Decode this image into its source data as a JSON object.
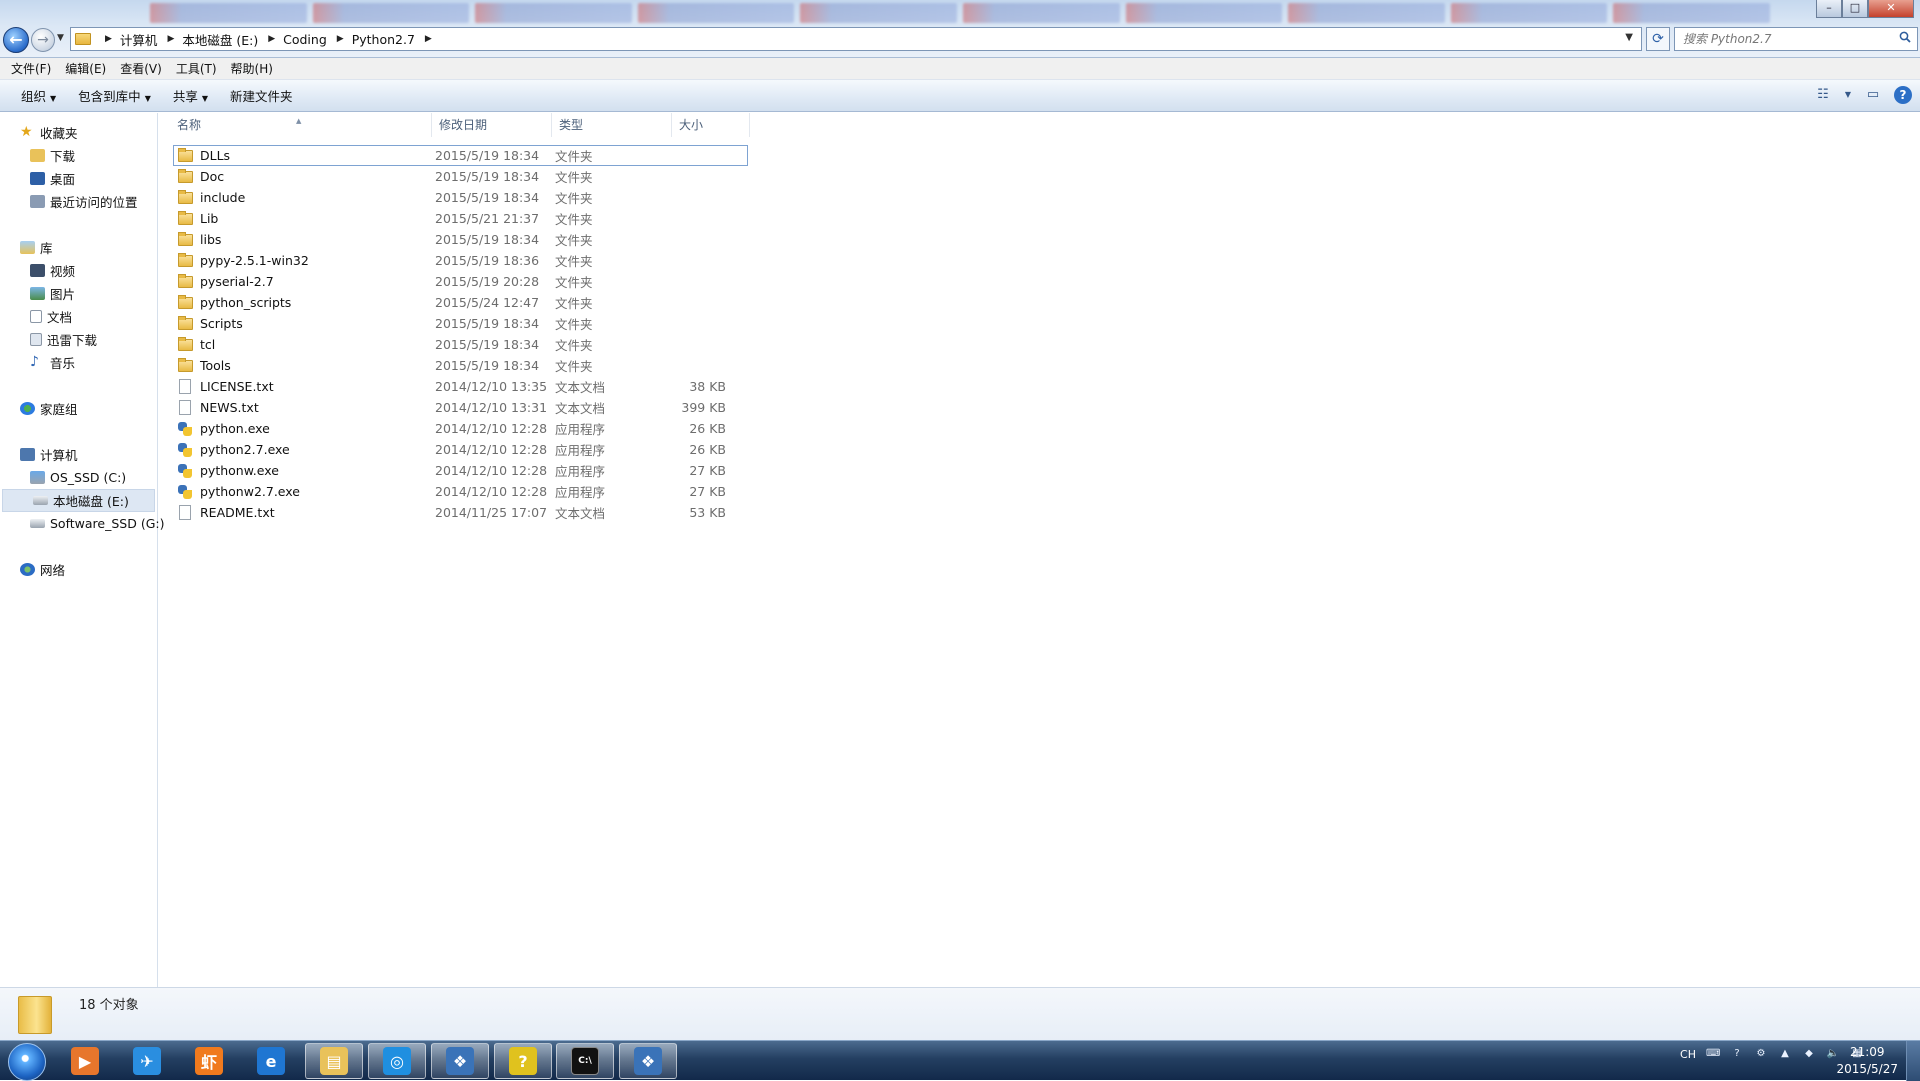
{
  "window": {
    "controls": {
      "minimize": "–",
      "maximize": "□",
      "close": "✕"
    }
  },
  "address": {
    "crumbs": [
      "计算机",
      "本地磁盘 (E:)",
      "Coding",
      "Python2.7"
    ],
    "search_placeholder": "搜索 Python2.7"
  },
  "menu": [
    "文件(F)",
    "编辑(E)",
    "查看(V)",
    "工具(T)",
    "帮助(H)"
  ],
  "toolbar": {
    "organize": "组织",
    "include_in_library": "包含到库中",
    "share": "共享",
    "new_folder": "新建文件夹"
  },
  "sidebar": {
    "favorites": {
      "label": "收藏夹",
      "items": [
        "下载",
        "桌面",
        "最近访问的位置"
      ]
    },
    "libraries": {
      "label": "库",
      "items": [
        "视频",
        "图片",
        "文档",
        "迅雷下载",
        "音乐"
      ]
    },
    "homegroup": "家庭组",
    "computer": {
      "label": "计算机",
      "items": [
        "OS_SSD (C:)",
        "本地磁盘 (E:)",
        "Software_SSD (G:)"
      ],
      "selected": "本地磁盘 (E:)"
    },
    "network": "网络"
  },
  "columns": {
    "name": "名称",
    "date": "修改日期",
    "type": "类型",
    "size": "大小"
  },
  "files": [
    {
      "name": "DLLs",
      "date": "2015/5/19 18:34",
      "type": "文件夹",
      "size": "",
      "icon": "folder"
    },
    {
      "name": "Doc",
      "date": "2015/5/19 18:34",
      "type": "文件夹",
      "size": "",
      "icon": "folder"
    },
    {
      "name": "include",
      "date": "2015/5/19 18:34",
      "type": "文件夹",
      "size": "",
      "icon": "folder"
    },
    {
      "name": "Lib",
      "date": "2015/5/21 21:37",
      "type": "文件夹",
      "size": "",
      "icon": "folder"
    },
    {
      "name": "libs",
      "date": "2015/5/19 18:34",
      "type": "文件夹",
      "size": "",
      "icon": "folder"
    },
    {
      "name": "pypy-2.5.1-win32",
      "date": "2015/5/19 18:36",
      "type": "文件夹",
      "size": "",
      "icon": "folder"
    },
    {
      "name": "pyserial-2.7",
      "date": "2015/5/19 20:28",
      "type": "文件夹",
      "size": "",
      "icon": "folder"
    },
    {
      "name": "python_scripts",
      "date": "2015/5/24 12:47",
      "type": "文件夹",
      "size": "",
      "icon": "folder"
    },
    {
      "name": "Scripts",
      "date": "2015/5/19 18:34",
      "type": "文件夹",
      "size": "",
      "icon": "folder"
    },
    {
      "name": "tcl",
      "date": "2015/5/19 18:34",
      "type": "文件夹",
      "size": "",
      "icon": "folder"
    },
    {
      "name": "Tools",
      "date": "2015/5/19 18:34",
      "type": "文件夹",
      "size": "",
      "icon": "folder"
    },
    {
      "name": "LICENSE.txt",
      "date": "2014/12/10 13:35",
      "type": "文本文档",
      "size": "38 KB",
      "icon": "text"
    },
    {
      "name": "NEWS.txt",
      "date": "2014/12/10 13:31",
      "type": "文本文档",
      "size": "399 KB",
      "icon": "text"
    },
    {
      "name": "python.exe",
      "date": "2014/12/10 12:28",
      "type": "应用程序",
      "size": "26 KB",
      "icon": "python"
    },
    {
      "name": "python2.7.exe",
      "date": "2014/12/10 12:28",
      "type": "应用程序",
      "size": "26 KB",
      "icon": "python"
    },
    {
      "name": "pythonw.exe",
      "date": "2014/12/10 12:28",
      "type": "应用程序",
      "size": "27 KB",
      "icon": "python"
    },
    {
      "name": "pythonw2.7.exe",
      "date": "2014/12/10 12:28",
      "type": "应用程序",
      "size": "27 KB",
      "icon": "python"
    },
    {
      "name": "README.txt",
      "date": "2014/11/25 17:07",
      "type": "文本文档",
      "size": "53 KB",
      "icon": "text"
    }
  ],
  "selected_file": "DLLs",
  "status": {
    "count": "18 个对象"
  },
  "taskbar": {
    "apps": [
      {
        "name": "media-player",
        "glyph": "▶",
        "color": "#e7762c"
      },
      {
        "name": "feiq-messenger",
        "glyph": "✈",
        "color": "#2a8ee0"
      },
      {
        "name": "xiami-music",
        "glyph": "虾",
        "color": "#f07a1e"
      },
      {
        "name": "internet-explorer",
        "glyph": "e",
        "color": "#1f76d2"
      },
      {
        "name": "windows-explorer",
        "glyph": "▤",
        "color": "#e9c25a"
      },
      {
        "name": "browser-360",
        "glyph": "◎",
        "color": "#1f8fe0"
      },
      {
        "name": "python-idle",
        "glyph": "❖",
        "color": "#3a73b8"
      },
      {
        "name": "help-viewer",
        "glyph": "?",
        "color": "#e0c21e"
      },
      {
        "name": "command-prompt",
        "glyph": "C:\\",
        "color": "#111111"
      },
      {
        "name": "python-shell",
        "glyph": "❖",
        "color": "#3a73b8"
      }
    ],
    "tray": {
      "ime": "CH",
      "date": "2015/5/27",
      "time": "21:09"
    }
  }
}
